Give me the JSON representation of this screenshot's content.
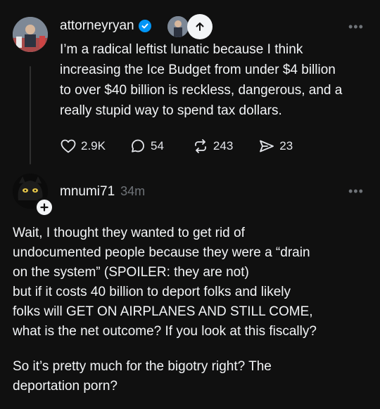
{
  "post": {
    "username": "attorneyryan",
    "text": "I’m a radical leftist lunatic because I think\nincreasing the Ice Budget from under $4 billion\nto over $40 billion is reckless, dangerous, and a\nreally stupid way to spend tax dollars.",
    "likes": "2.9K",
    "replies": "54",
    "reposts": "243",
    "shares": "23",
    "more": "•••"
  },
  "reply": {
    "username": "mnumi71",
    "time": "34m",
    "more": "•••",
    "paragraph1": "Wait, I thought they wanted to get rid of\nundocumented people because they were a “drain\non the system” (SPOILER: they are not)\nbut if it costs 40 billion to deport folks and likely\nfolks will GET ON AIRPLANES AND STILL COME,\nwhat is the net outcome? If you look at this fiscally?",
    "paragraph2": "So it’s pretty much for the bigotry right? The\ndeportation porn?"
  },
  "colors": {
    "background": "#101010",
    "text": "#f3f5f7",
    "muted": "#6f7378",
    "verified": "#0095f6"
  }
}
